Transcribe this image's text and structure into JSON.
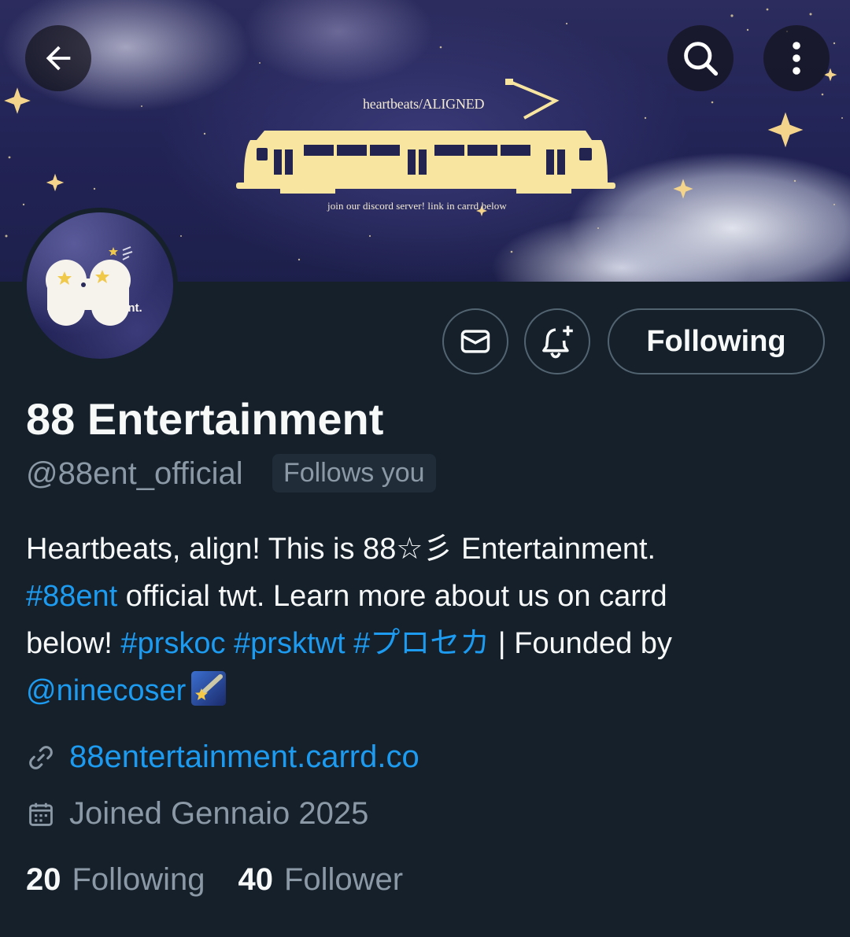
{
  "banner": {
    "title": "heartbeats/ALIGNED",
    "caption": "join our discord server! link in carrd below"
  },
  "header": {
    "back_icon": "arrow-left-icon",
    "search_icon": "search-icon",
    "more_icon": "more-vertical-icon"
  },
  "avatar": {
    "logo_text": "88",
    "logo_sub": "ent."
  },
  "actions": {
    "message_icon": "mail-icon",
    "notify_icon": "bell-plus-icon",
    "follow_label": "Following"
  },
  "profile": {
    "display_name": "88 Entertainment",
    "handle": "@88ent_official",
    "follows_you": "Follows you",
    "bio": {
      "line1": "Heartbeats, align! This is 88☆彡 Entertainment.",
      "line2_tag": "#88ent",
      "line2_text": " official twt. Learn more about us on carrd",
      "line3_text": "below! ",
      "line3_tags": [
        "#prskoc",
        "#prsktwt",
        "#プロセカ"
      ],
      "line3_after": " | Founded by",
      "line4_mention": "@ninecoser"
    },
    "website": "88entertainment.carrd.co",
    "joined": "Joined Gennaio 2025"
  },
  "stats": {
    "following_count": "20",
    "following_label": "Following",
    "follower_count": "40",
    "follower_label": "Follower"
  },
  "colors": {
    "background": "#15202b",
    "link": "#1d9bf0",
    "secondary_text": "#8b98a5",
    "tram": "#f8e6a0"
  }
}
